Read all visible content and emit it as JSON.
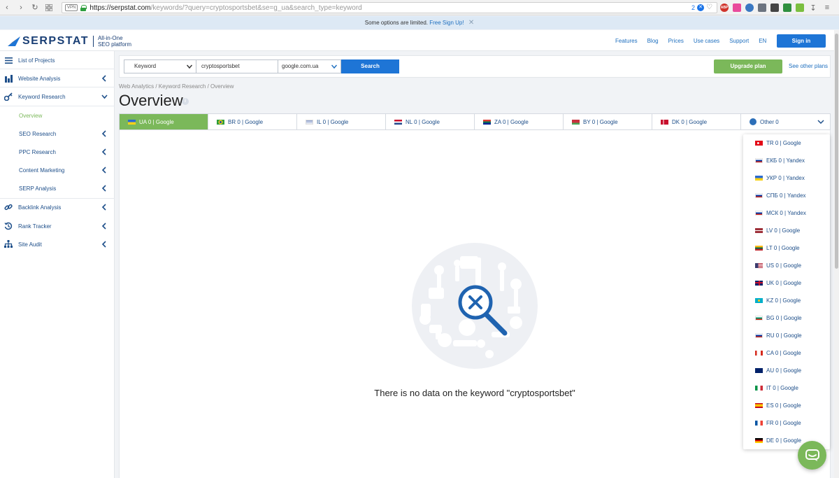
{
  "browser": {
    "url_host": "https://serpstat.com",
    "url_path": "/keywords/?query=cryptosportsbet&se=g_ua&search_type=keyword",
    "badge_count": "2",
    "vpn_label": "VPN",
    "abp_label": "ABP"
  },
  "notice": {
    "text": "Some options are limited.",
    "link": "Free Sign Up!",
    "close": "✕"
  },
  "header": {
    "logo": "SERPSTAT",
    "tagline_1": "All-in-One",
    "tagline_2": "SEO platform",
    "nav": [
      "Features",
      "Blog",
      "Prices",
      "Use cases",
      "Support"
    ],
    "lang": "EN",
    "signin": "Sign in"
  },
  "sidebar": {
    "list_of_projects": "List of Projects",
    "website_analysis": "Website Analysis",
    "keyword_research": "Keyword Research",
    "overview": "Overview",
    "seo_research": "SEO Research",
    "ppc_research": "PPC Research",
    "content_marketing": "Content Marketing",
    "serp_analysis": "SERP Analysis",
    "backlink_analysis": "Backlink Analysis",
    "rank_tracker": "Rank Tracker",
    "site_audit": "Site Audit",
    "accent_color": "#7bb85a"
  },
  "search": {
    "type": "Keyword",
    "query": "cryptosportsbet",
    "database": "google.com.ua",
    "button": "Search",
    "upgrade": "Upgrade plan",
    "other_plans": "See other plans"
  },
  "breadcrumb": "Web Analytics / Keyword Research / Overview",
  "page_title": "Overview",
  "tabs": [
    {
      "label": "UA 0 | Google",
      "flag": "ua"
    },
    {
      "label": "BR 0 | Google",
      "flag": "br"
    },
    {
      "label": "IL 0 | Google",
      "flag": "il"
    },
    {
      "label": "NL 0 | Google",
      "flag": "nl"
    },
    {
      "label": "ZA 0 | Google",
      "flag": "za"
    },
    {
      "label": "BY 0 | Google",
      "flag": "by"
    },
    {
      "label": "DK 0 | Google",
      "flag": "dk"
    },
    {
      "label": "Other 0",
      "flag": "globe"
    }
  ],
  "dropdown": [
    {
      "label": "TR 0 | Google",
      "flag": "tr"
    },
    {
      "label": "ЕКБ 0 | Yandex",
      "flag": "ru"
    },
    {
      "label": "УКР 0 | Yandex",
      "flag": "ua"
    },
    {
      "label": "СПБ 0 | Yandex",
      "flag": "ru"
    },
    {
      "label": "МСК 0 | Yandex",
      "flag": "ru"
    },
    {
      "label": "LV 0 | Google",
      "flag": "lv"
    },
    {
      "label": "LT 0 | Google",
      "flag": "lt"
    },
    {
      "label": "US 0 | Google",
      "flag": "us"
    },
    {
      "label": "UK 0 | Google",
      "flag": "uk"
    },
    {
      "label": "KZ 0 | Google",
      "flag": "kz"
    },
    {
      "label": "BG 0 | Google",
      "flag": "bg"
    },
    {
      "label": "RU 0 | Google",
      "flag": "ru"
    },
    {
      "label": "CA 0 | Google",
      "flag": "ca"
    },
    {
      "label": "AU 0 | Google",
      "flag": "au"
    },
    {
      "label": "IT 0 | Google",
      "flag": "it"
    },
    {
      "label": "ES 0 | Google",
      "flag": "es"
    },
    {
      "label": "FR 0 | Google",
      "flag": "fr"
    },
    {
      "label": "DE 0 | Google",
      "flag": "de"
    }
  ],
  "empty_message": "There is no data on the keyword \"cryptosportsbet\""
}
